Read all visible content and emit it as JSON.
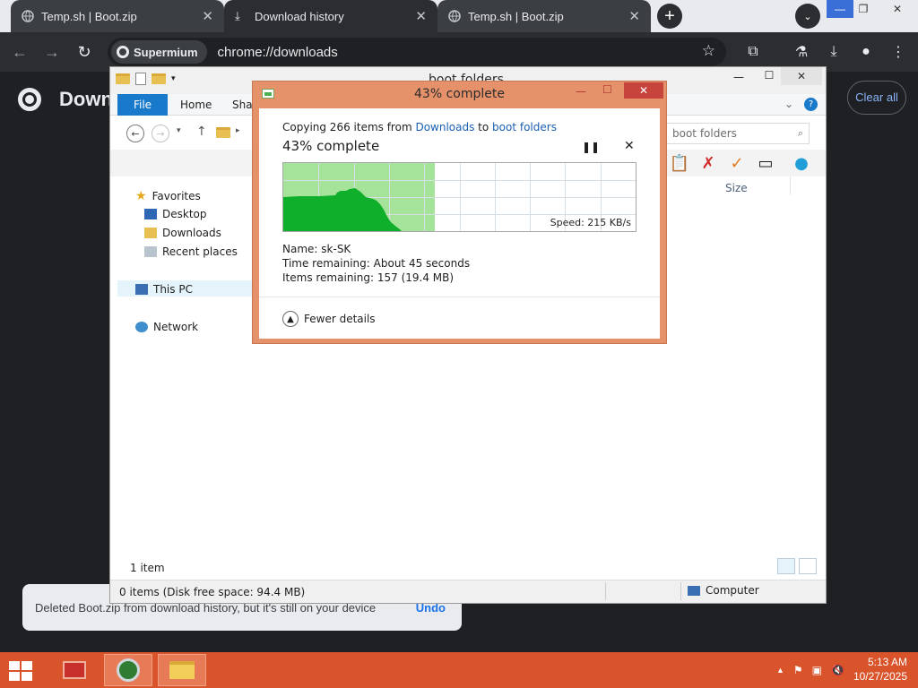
{
  "browser": {
    "tabs": [
      {
        "title": "Temp.sh | Boot.zip"
      },
      {
        "title": "Download history"
      },
      {
        "title": "Temp.sh | Boot.zip"
      }
    ],
    "site_chip": "Supermium",
    "url": "chrome://downloads"
  },
  "downloads_page": {
    "heading": "Down",
    "clear_all": "Clear all"
  },
  "toast": {
    "message": "Deleted Boot.zip from download history, but it's still on your device",
    "undo": "Undo"
  },
  "explorer": {
    "title": "boot folders",
    "ribbon_tabs": {
      "file": "File",
      "home": "Home",
      "share": "Shar"
    },
    "search_placeholder": "boot folders",
    "column_size": "Size",
    "nav": {
      "favorites": "Favorites",
      "desktop": "Desktop",
      "downloads": "Downloads",
      "recent": "Recent places",
      "this_pc": "This PC",
      "network": "Network"
    },
    "status_items": "1 item",
    "status_disk": "0 items (Disk free space: 94.4 MB)",
    "status_location": "Computer"
  },
  "copy_dialog": {
    "title": "43% complete",
    "copy_prefix": "Copying 266 items from ",
    "from": "Downloads",
    "to_word": " to ",
    "to": "boot folders",
    "progress_label": "43% complete",
    "progress": 0.43,
    "speed": "Speed: 215 KB/s",
    "name_label": "Name:",
    "name_value": "sk-SK",
    "time_label": "Time remaining:",
    "time_value": "About 45 seconds",
    "items_label": "Items remaining:",
    "items_value": "157 (19.4 MB)",
    "fewer_details": "Fewer details"
  },
  "taskbar": {
    "time": "5:13 AM",
    "date": "10/27/2025"
  },
  "colors": {
    "taskbar": "#d9532b",
    "dialog_frame": "#e5926b",
    "progress_fill": "#a6e39a",
    "speed_area": "#0fae2b",
    "link": "#1a5fb4"
  }
}
